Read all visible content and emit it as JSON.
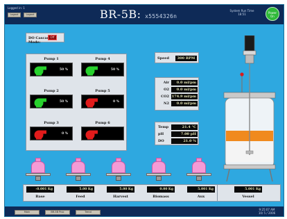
{
  "header": {
    "logged_in": "Logged in: 1",
    "btn_left": "Logout",
    "btn_right": "Logout",
    "title": "BR-5B:",
    "serial": "x5554326n",
    "system_time_label": "System Run Time",
    "system_time_value": "18:51",
    "status": "Power On"
  },
  "cascade": {
    "label": "DO Cascade Mode:",
    "value": "Off",
    "color": "#8a0e0e"
  },
  "pumps": [
    {
      "name": "Pump 1",
      "value": "50 %",
      "state_color": "#27d22d"
    },
    {
      "name": "Pump 4",
      "value": "50 %",
      "state_color": "#27d22d"
    },
    {
      "name": "Pump 2",
      "value": "50 %",
      "state_color": "#27d22d"
    },
    {
      "name": "Pump 5",
      "value": "0 %",
      "state_color": "#e21b1b"
    },
    {
      "name": "Pump 3",
      "value": "0 %",
      "state_color": "#e21b1b"
    },
    {
      "name": "Pump 6",
      "value": "",
      "state_color": "#e21b1b"
    }
  ],
  "speed": {
    "label": "Speed",
    "value": "300 RPM"
  },
  "gas": [
    {
      "label": "Air",
      "value": "0.0 ml/pm"
    },
    {
      "label": "O2",
      "value": "0.0 ml/pm"
    },
    {
      "label": "CO2",
      "value": "174.9 ml/pm"
    },
    {
      "label": "N2",
      "value": "0.0 ml/pm"
    }
  ],
  "env": [
    {
      "label": "Temp",
      "value": "21.4 °C"
    },
    {
      "label": "pH",
      "value": "7.00 pH"
    },
    {
      "label": "DO",
      "value": "21.0 %"
    }
  ],
  "weights": [
    {
      "label": "Base",
      "value": "-0.001 Kg"
    },
    {
      "label": "Feed",
      "value": "5.00 Kg"
    },
    {
      "label": "Harvest",
      "value": "5.00 Kg"
    },
    {
      "label": "Biomass",
      "value": "0.00 Kg"
    },
    {
      "label": "Aux",
      "value": "5.001 Kg"
    },
    {
      "label": "Vessel",
      "value": "5.001 Kg"
    }
  ],
  "vessel": {
    "liquid_color": "#f08a1e",
    "accent_color": "#d91c1c"
  },
  "footer": {
    "btn_main": "Main",
    "btn_proc": "BR-5B Proc",
    "btn_trend": "Trend",
    "clock_time": "9:25:07 AM",
    "clock_date": "10/ 5 / 2006"
  },
  "colors": {
    "screen_bg": "#2ea8e0",
    "header_bg": "#0e2a57",
    "panel_bg": "#dfe4ea"
  }
}
